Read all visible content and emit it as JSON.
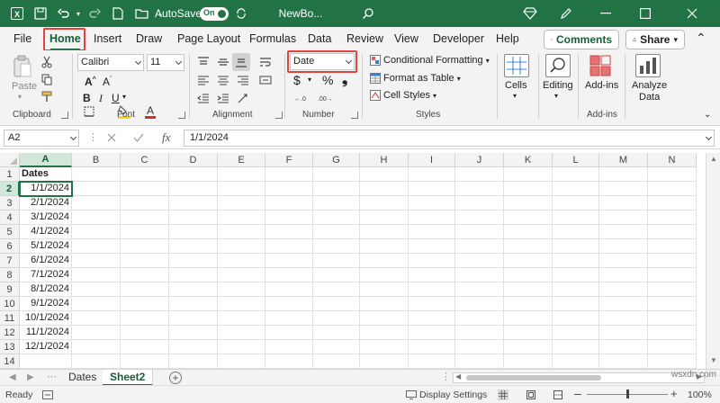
{
  "titlebar": {
    "autosave_label": "AutoSave",
    "autosave_state": "On",
    "filename": "NewBo...",
    "icons": [
      "excel-app-icon",
      "save-icon",
      "undo-icon",
      "redo-icon",
      "new-doc-icon",
      "folder-icon",
      "customize-icon",
      "search-icon",
      "diamond-icon",
      "pen-icon",
      "minimize-icon",
      "maximize-icon",
      "close-icon"
    ]
  },
  "menu": {
    "tabs": [
      "File",
      "Home",
      "Insert",
      "Draw",
      "Page Layout",
      "Formulas",
      "Data",
      "Review",
      "View",
      "Developer",
      "Help"
    ],
    "active": "Home",
    "comments_label": "Comments",
    "share_label": "Share"
  },
  "ribbon": {
    "clipboard": {
      "paste_label": "Paste",
      "group_label": "Clipboard"
    },
    "font": {
      "font_name": "Calibri",
      "font_size": "11",
      "group_label": "Font"
    },
    "alignment": {
      "group_label": "Alignment"
    },
    "number": {
      "format": "Date",
      "group_label": "Number",
      "currency_symbol": "$",
      "percent_symbol": "%",
      "comma_symbol": "❟"
    },
    "styles": {
      "conditional_formatting": "Conditional Formatting",
      "format_as_table": "Format as Table",
      "cell_styles": "Cell Styles",
      "group_label": "Styles"
    },
    "cells": {
      "label": "Cells"
    },
    "editing": {
      "label": "Editing"
    },
    "addins": {
      "label": "Add-ins",
      "group_label": "Add-ins"
    },
    "analyze": {
      "label1": "Analyze",
      "label2": "Data"
    },
    "colors": {
      "highlight": "#f5d416",
      "font_color": "#d32f2f",
      "accent": "#217346"
    }
  },
  "formulabar": {
    "name_box": "A2",
    "fx_label": "fx",
    "value": "1/1/2024"
  },
  "grid": {
    "columns": [
      "A",
      "B",
      "C",
      "D",
      "E",
      "F",
      "G",
      "H",
      "I",
      "J",
      "K",
      "L",
      "M",
      "N"
    ],
    "rows": [
      "1",
      "2",
      "3",
      "4",
      "5",
      "6",
      "7",
      "8",
      "9",
      "10",
      "11",
      "12",
      "13",
      "14"
    ],
    "selected_cell": "A2",
    "header": "Dates",
    "dates": [
      "1/1/2024",
      "2/1/2024",
      "3/1/2024",
      "4/1/2024",
      "5/1/2024",
      "6/1/2024",
      "7/1/2024",
      "8/1/2024",
      "9/1/2024",
      "10/1/2024",
      "11/1/2024",
      "12/1/2024"
    ]
  },
  "sheets": {
    "tabs": [
      "Dates",
      "Sheet2"
    ],
    "active": "Sheet2"
  },
  "status": {
    "ready": "Ready",
    "display_settings": "Display Settings",
    "zoom": "100%",
    "watermark": "wsxdn.com"
  }
}
